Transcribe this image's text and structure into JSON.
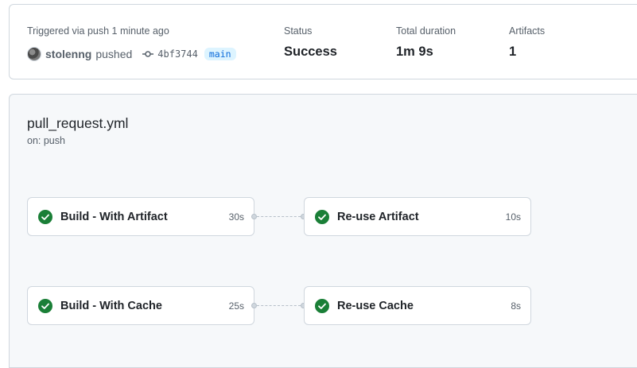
{
  "summary": {
    "trigger_text": "Triggered via push 1 minute ago",
    "actor": "stolenng",
    "action": "pushed",
    "commit_sha": "4bf3744",
    "branch": "main",
    "status_label": "Status",
    "status_value": "Success",
    "duration_label": "Total duration",
    "duration_value": "1m 9s",
    "artifacts_label": "Artifacts",
    "artifacts_value": "1"
  },
  "workflow": {
    "file": "pull_request.yml",
    "trigger": "on: push",
    "jobs": [
      {
        "name": "Build - With Artifact",
        "duration": "30s",
        "status": "success"
      },
      {
        "name": "Re-use Artifact",
        "duration": "10s",
        "status": "success"
      },
      {
        "name": "Build - With Cache",
        "duration": "25s",
        "status": "success"
      },
      {
        "name": "Re-use Cache",
        "duration": "8s",
        "status": "success"
      }
    ]
  },
  "colors": {
    "success": "#1a7f37",
    "branch_bg": "#ddf4ff",
    "branch_fg": "#0969da",
    "border": "#d0d7de"
  },
  "icons": {
    "commit": "git-commit-icon",
    "success": "check-circle-fill-icon"
  }
}
